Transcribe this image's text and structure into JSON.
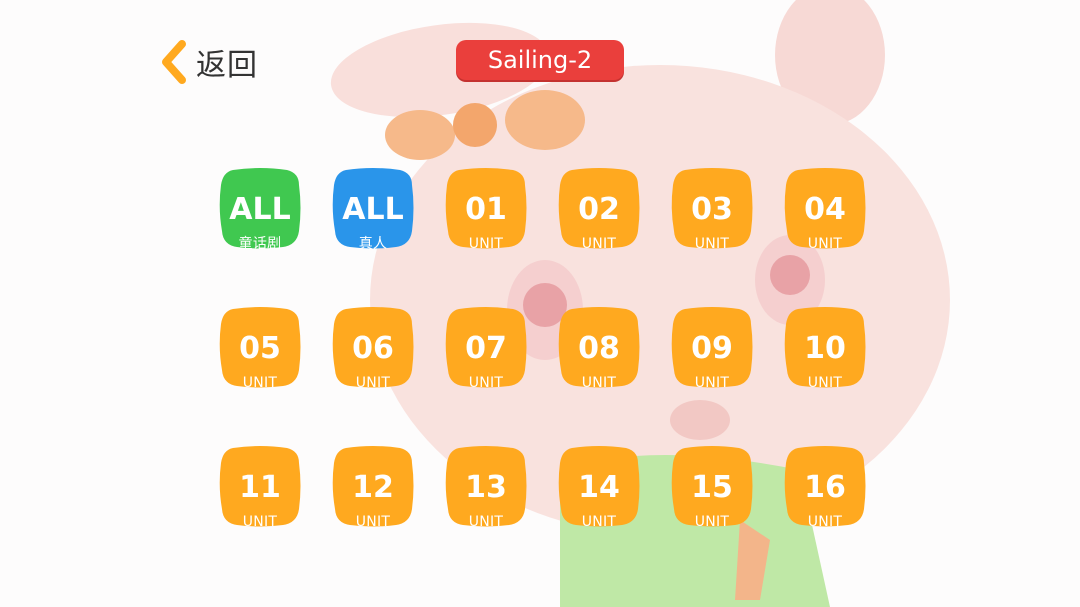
{
  "header": {
    "back_label": "返回",
    "title": "Sailing-2"
  },
  "colors": {
    "accent_orange": "#ffa91f",
    "green_tile": "#40c850",
    "blue_tile": "#2a95ea",
    "title_red": "#ea3f3c"
  },
  "tiles": [
    {
      "label": "ALL",
      "sub": "童话剧",
      "color": "green"
    },
    {
      "label": "ALL",
      "sub": "真人",
      "color": "blue"
    },
    {
      "label": "01",
      "sub": "UNIT",
      "color": "orange"
    },
    {
      "label": "02",
      "sub": "UNIT",
      "color": "orange"
    },
    {
      "label": "03",
      "sub": "UNIT",
      "color": "orange"
    },
    {
      "label": "04",
      "sub": "UNIT",
      "color": "orange"
    },
    {
      "label": "05",
      "sub": "UNIT",
      "color": "orange"
    },
    {
      "label": "06",
      "sub": "UNIT",
      "color": "orange"
    },
    {
      "label": "07",
      "sub": "UNIT",
      "color": "orange"
    },
    {
      "label": "08",
      "sub": "UNIT",
      "color": "orange"
    },
    {
      "label": "09",
      "sub": "UNIT",
      "color": "orange"
    },
    {
      "label": "10",
      "sub": "UNIT",
      "color": "orange"
    },
    {
      "label": "11",
      "sub": "UNIT",
      "color": "orange"
    },
    {
      "label": "12",
      "sub": "UNIT",
      "color": "orange"
    },
    {
      "label": "13",
      "sub": "UNIT",
      "color": "orange"
    },
    {
      "label": "14",
      "sub": "UNIT",
      "color": "orange"
    },
    {
      "label": "15",
      "sub": "UNIT",
      "color": "orange"
    },
    {
      "label": "16",
      "sub": "UNIT",
      "color": "orange"
    }
  ]
}
